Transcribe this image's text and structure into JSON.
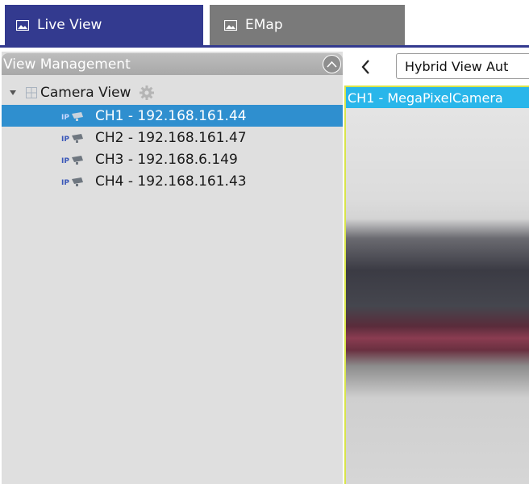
{
  "tabs": [
    {
      "label": "Live View",
      "icon": "image-icon",
      "active": true
    },
    {
      "label": "EMap",
      "icon": "image-icon",
      "active": false
    }
  ],
  "colors": {
    "active_tab": "#333a8f",
    "inactive_tab": "#7a7a7a",
    "selection": "#2f8fcf",
    "camera_label_bg": "#29b6ea",
    "video_border": "#d8e44a"
  },
  "sidebar": {
    "header_title": "View Management",
    "collapse_icon": "chevron-up-icon",
    "root": {
      "label": "Camera View",
      "expanded": true,
      "icon": "grid-icon",
      "settings_icon": "gear-icon"
    },
    "channels": [
      {
        "label": "CH1 - 192.168.161.44",
        "icon": "ip-camera-icon",
        "selected": true
      },
      {
        "label": "CH2 - 192.168.161.47",
        "icon": "ip-camera-icon",
        "selected": false
      },
      {
        "label": "CH3 - 192.168.6.149",
        "icon": "ip-camera-icon",
        "selected": false
      },
      {
        "label": "CH4 - 192.168.161.43",
        "icon": "ip-camera-icon",
        "selected": false
      }
    ]
  },
  "content": {
    "back_icon": "chevron-left-icon",
    "view_select_value": "Hybrid View Aut",
    "camera_label": "CH1 - MegaPixelCamera"
  }
}
